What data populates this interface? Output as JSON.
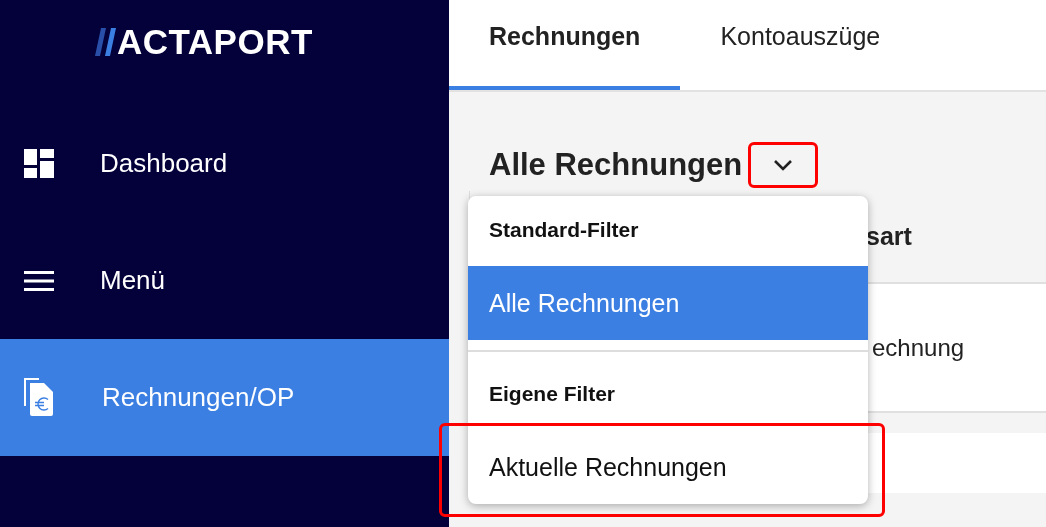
{
  "logo": {
    "text": "ACTAPORT"
  },
  "sidebar": {
    "items": [
      {
        "label": "Dashboard",
        "selected": false
      },
      {
        "label": "Menü",
        "selected": false
      },
      {
        "label": "Rechnungen/OP",
        "selected": true
      }
    ]
  },
  "tabs": [
    {
      "label": "Rechnungen",
      "selected": true
    },
    {
      "label": "Kontoauszüge",
      "selected": false
    }
  ],
  "filter": {
    "title": "Alle Rechnungen",
    "toggle_highlighted": true
  },
  "table": {
    "column_1": "sart",
    "rows": [
      {
        "column_1": "echnung"
      }
    ]
  },
  "dropdown": {
    "groups": [
      {
        "heading": "Standard-Filter",
        "items": [
          {
            "label": "Alle Rechnungen",
            "selected": true,
            "highlighted": false
          }
        ]
      },
      {
        "heading": "Eigene Filter",
        "items": [
          {
            "label": "Aktuelle Rechnungen",
            "selected": false,
            "highlighted": true
          }
        ]
      }
    ]
  }
}
